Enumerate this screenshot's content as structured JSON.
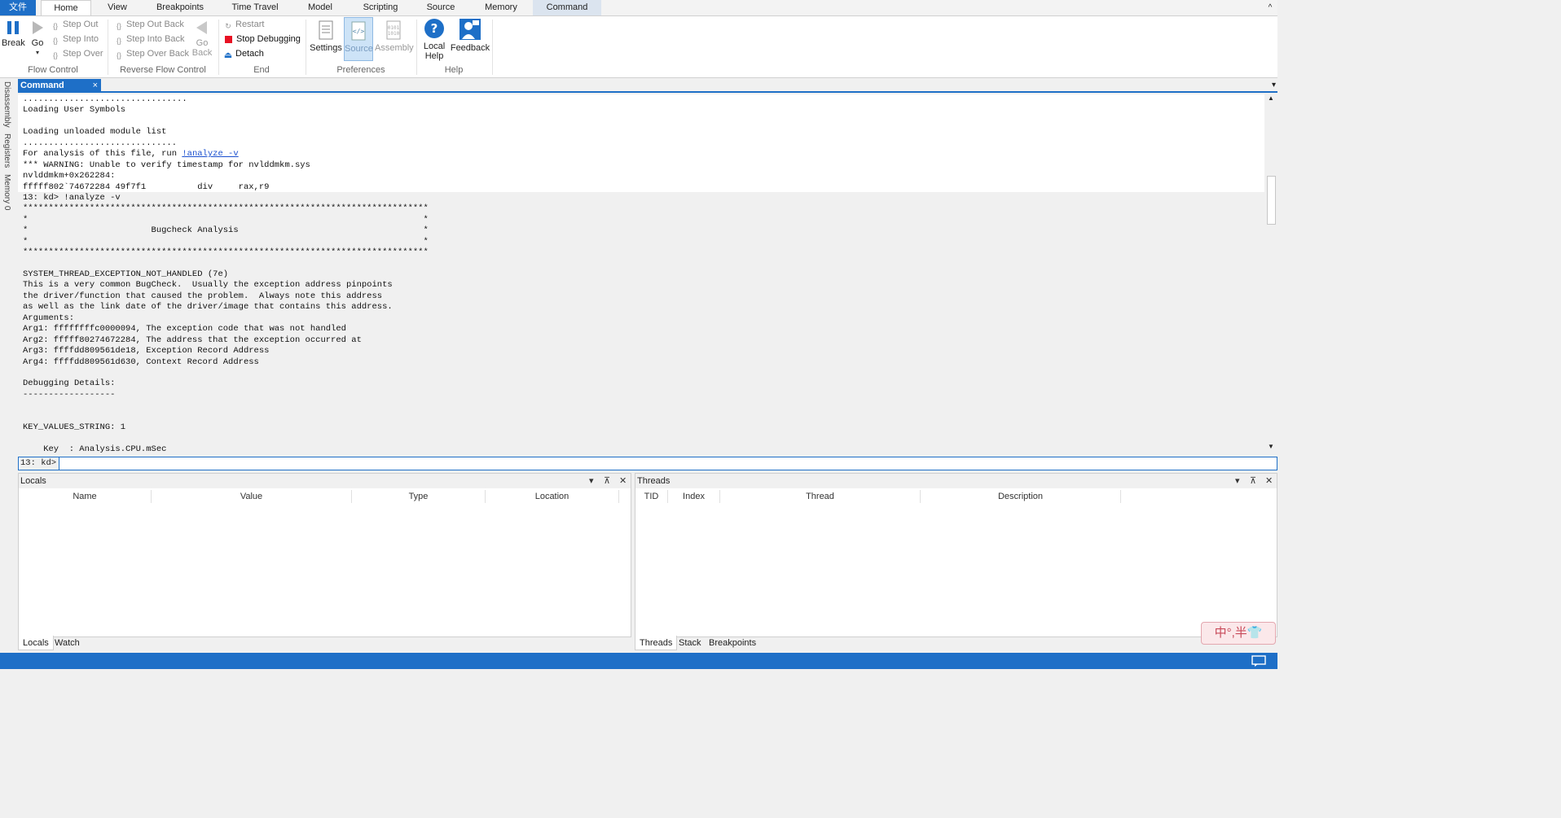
{
  "menu": {
    "file": "文件",
    "tabs": [
      "Home",
      "View",
      "Breakpoints",
      "Time Travel",
      "Model",
      "Scripting",
      "Source",
      "Memory",
      "Command"
    ],
    "collapse_glyph": "^"
  },
  "ribbon": {
    "flow_control": {
      "break": "Break",
      "go": "Go",
      "step_out": "Step Out",
      "step_into": "Step Into",
      "step_over": "Step Over",
      "label": "Flow Control"
    },
    "reverse_flow": {
      "step_out_back": "Step Out Back",
      "step_into_back": "Step Into Back",
      "step_over_back": "Step Over Back",
      "go_back_1": "Go",
      "go_back_2": "Back",
      "label": "Reverse Flow Control"
    },
    "end": {
      "restart": "Restart",
      "stop": "Stop Debugging",
      "detach": "Detach",
      "label": "End"
    },
    "preferences": {
      "settings": "Settings",
      "source": "Source",
      "assembly": "Assembly",
      "label": "Preferences"
    },
    "help": {
      "local_help_1": "Local",
      "local_help_2": "Help",
      "feedback": "Feedback",
      "label": "Help"
    }
  },
  "side_tabs": [
    "Disassembly",
    "Registers",
    "Memory 0"
  ],
  "command_window": {
    "tab": "Command",
    "close": "×",
    "dropdown": "▾",
    "lines": [
      "................................",
      "Loading User Symbols",
      "",
      "Loading unloaded module list",
      "..............................",
      "For analysis of this file, run !analyze -v",
      "*** WARNING: Unable to verify timestamp for nvlddmkm.sys",
      "nvlddmkm+0x262284:",
      "fffff802`74672284 49f7f1          div     rax,r9",
      "13: kd> !analyze -v",
      "*******************************************************************************",
      "*                                                                             *",
      "*                        Bugcheck Analysis                                    *",
      "*                                                                             *",
      "*******************************************************************************",
      "",
      "SYSTEM_THREAD_EXCEPTION_NOT_HANDLED (7e)",
      "This is a very common BugCheck.  Usually the exception address pinpoints",
      "the driver/function that caused the problem.  Always note this address",
      "as well as the link date of the driver/image that contains this address.",
      "Arguments:",
      "Arg1: ffffffffc0000094, The exception code that was not handled",
      "Arg2: fffff80274672284, The address that the exception occurred at",
      "Arg3: ffffdd809561de18, Exception Record Address",
      "Arg4: ffffdd809561d630, Context Record Address",
      "",
      "Debugging Details:",
      "------------------",
      "",
      "",
      "KEY_VALUES_STRING: 1",
      "",
      "    Key  : Analysis.CPU.mSec"
    ],
    "link_prefix": "For analysis of this file, run ",
    "link_text": "!analyze -v",
    "prompt": "13: kd>",
    "input_value": ""
  },
  "locals_panel": {
    "title": "Locals",
    "columns": [
      "Name",
      "Value",
      "Type",
      "Location"
    ],
    "tabs": [
      "Locals",
      "Watch"
    ]
  },
  "threads_panel": {
    "title": "Threads",
    "columns": [
      "TID",
      "Index",
      "Thread",
      "Description"
    ],
    "tabs": [
      "Threads",
      "Stack",
      "Breakpoints"
    ]
  },
  "panel_controls": {
    "dropdown": "▾",
    "pin": "⊼",
    "close": "✕"
  },
  "ime": {
    "text": "中°,半👕"
  },
  "colors": {
    "accent": "#1e6fc7",
    "stop": "#e81123"
  }
}
